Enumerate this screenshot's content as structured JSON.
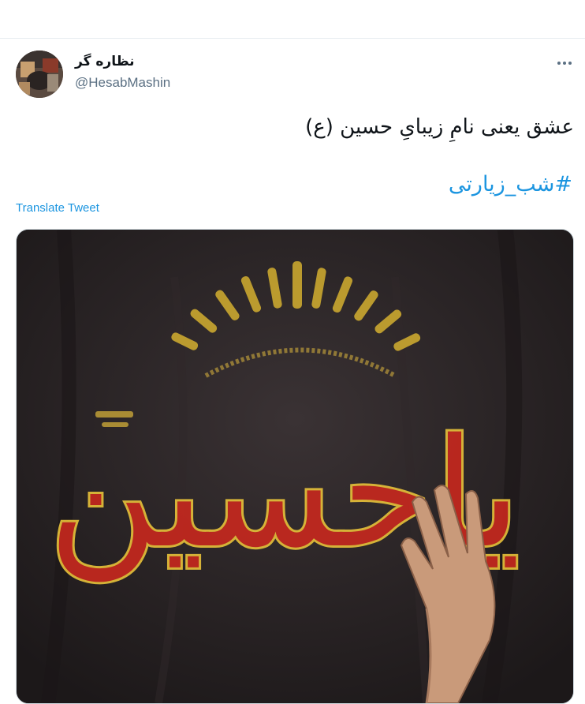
{
  "tweet": {
    "author": {
      "display_name": "نظاره گر",
      "handle": "@HesabMashin",
      "avatar_icon": "profile-photo"
    },
    "more_icon": "more-horizontal-icon",
    "text": "عشق یعنی نامِ زیبایِ حسین (ع)",
    "hashtag": "#شب_زیارتی",
    "translate_label": "Translate Tweet",
    "media": {
      "description_icon": "photo",
      "banner_text": "یاحسین"
    }
  },
  "colors": {
    "link": "#1b95e0",
    "text": "#0f1419",
    "secondary": "#5b7083",
    "banner_red": "#c8281e",
    "banner_gold": "#e8c23a"
  }
}
